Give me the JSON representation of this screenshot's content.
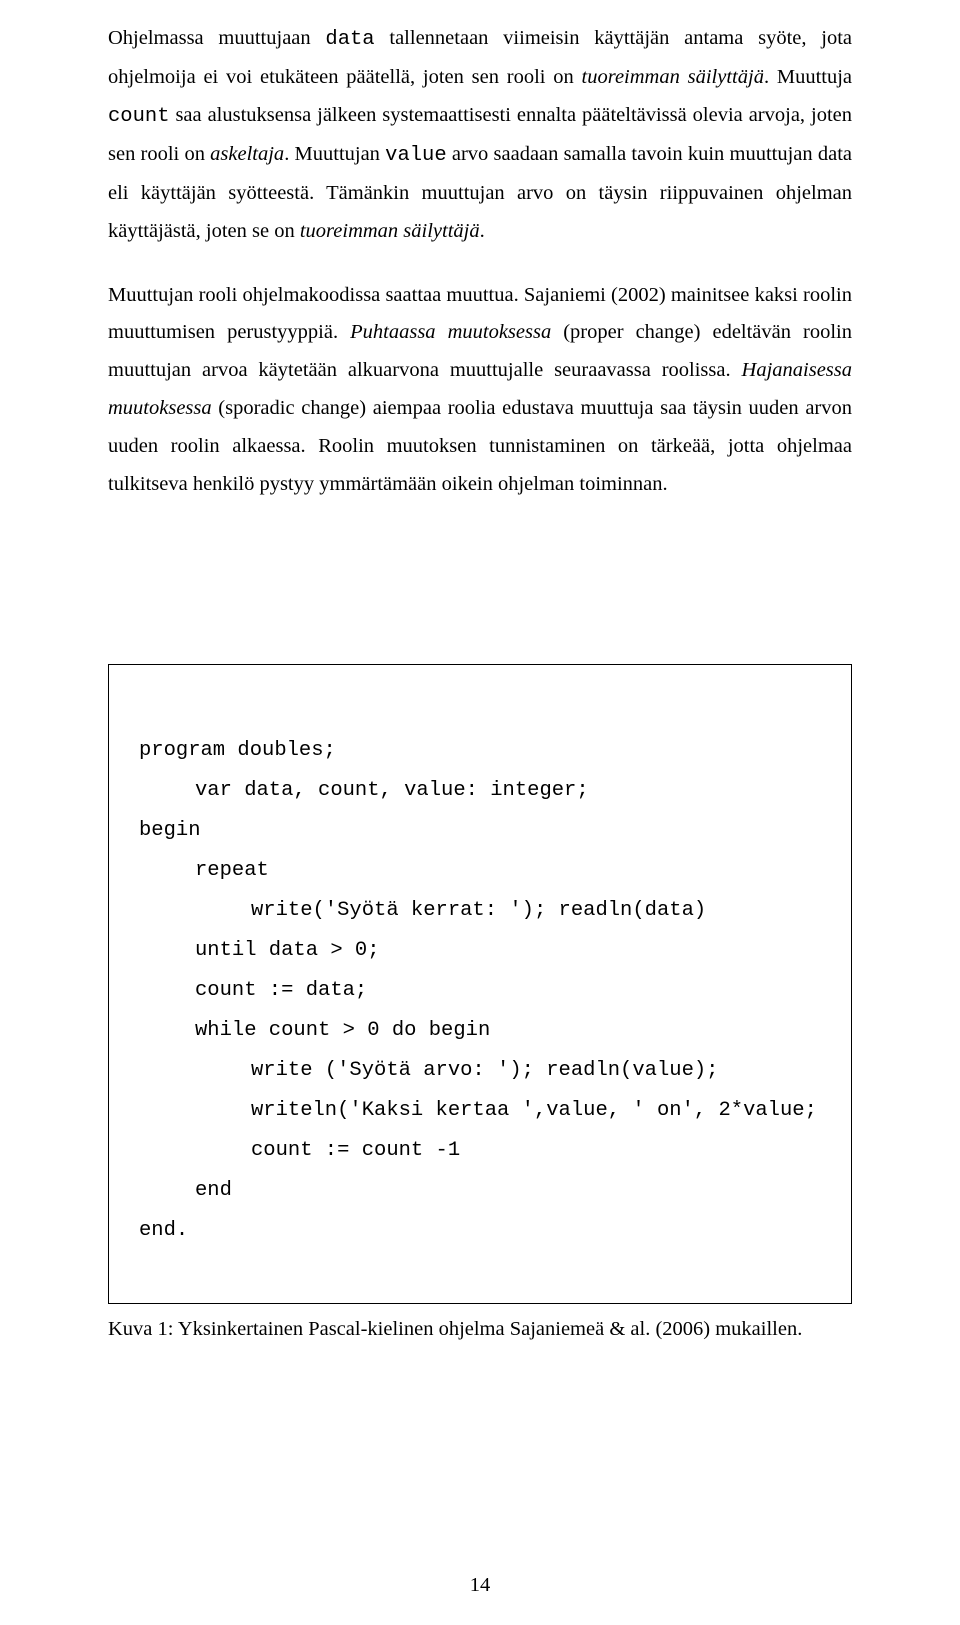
{
  "paragraphs": {
    "p1": {
      "s1a": "Ohjelmassa muuttujaan ",
      "s1b": "data",
      "s1c": " tallennetaan viimeisin käyttäjän antama syöte, jota ohjelmoija ei voi etukäteen päätellä, joten sen rooli on ",
      "s1d": "tuoreimman säilyttäjä",
      "s1e": ". Muuttuja ",
      "s1f": "count",
      "s1g": " saa alustuksensa jälkeen systemaattisesti ennalta pääteltävissä olevia arvoja, joten sen rooli on ",
      "s1h": "askeltaja",
      "s1i": ". Muuttujan ",
      "s1j": "value",
      "s1k": " arvo saadaan samalla tavoin kuin muuttujan data eli käyttäjän syötteestä. Tämänkin muuttujan arvo on täysin riippuvainen ohjelman käyttäjästä, joten se on ",
      "s1l": "tuoreimman säilyttäjä",
      "s1m": "."
    },
    "p2": {
      "s2a": "Muuttujan rooli ohjelmakoodissa saattaa muuttua. Sajaniemi (2002) mainitsee kaksi roolin muuttumisen perustyyppiä. ",
      "s2b": "Puhtaassa muutoksessa",
      "s2c": " (proper change) edeltävän roolin muuttujan arvoa käytetään alkuarvona muuttujalle seuraavassa roolissa. ",
      "s2d": "Hajanaisessa muutoksessa",
      "s2e": " (sporadic change) aiempaa roolia edustava muuttuja saa täysin uuden arvon uuden roolin alkaessa. Roolin muutoksen tunnistaminen on tärkeää, jotta ohjelmaa tulkitseva henkilö pystyy ymmärtämään oikein ohjelman toiminnan."
    }
  },
  "code": {
    "l1": "program doubles;",
    "l2": "var data, count, value: integer;",
    "l3": "begin",
    "l4": "repeat",
    "l5": "write('Syötä kerrat: '); readln(data)",
    "l6": "until data > 0;",
    "l7": "count := data;",
    "l8": "while count > 0 do begin",
    "l9": "write ('Syötä arvo: '); readln(value);",
    "l10": "writeln('Kaksi kertaa ',value, ' on', 2*value;",
    "l11": "count := count -1",
    "l12": "end",
    "l13": "end."
  },
  "caption": "Kuva 1: Yksinkertainen Pascal-kielinen ohjelma Sajaniemeä & al. (2006) mukaillen.",
  "page_number": "14"
}
